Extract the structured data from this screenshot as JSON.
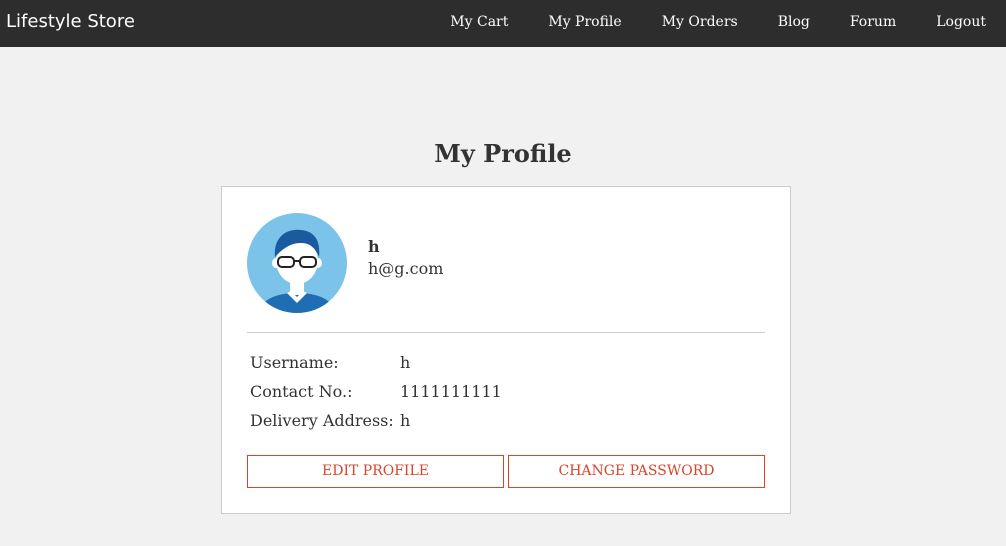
{
  "navbar": {
    "brand": "Lifestyle Store",
    "links": [
      "My Cart",
      "My Profile",
      "My Orders",
      "Blog",
      "Forum",
      "Logout"
    ]
  },
  "page": {
    "title": "My Profile"
  },
  "profile": {
    "name": "h",
    "email": "h@g.com",
    "details": [
      {
        "label": "Username:",
        "value": "h"
      },
      {
        "label": "Contact No.:",
        "value": "1111111111"
      },
      {
        "label": "Delivery Address:",
        "value": "h"
      }
    ]
  },
  "actions": {
    "edit_label": "EDIT PROFILE",
    "change_password_label": "CHANGE PASSWORD"
  },
  "colors": {
    "navbar_bg": "#2d2d2d",
    "page_bg": "#f1f1f1",
    "accent": "#d9452a",
    "avatar_bg": "#7cc3ea"
  },
  "icons": {
    "avatar": "user-avatar-icon"
  }
}
